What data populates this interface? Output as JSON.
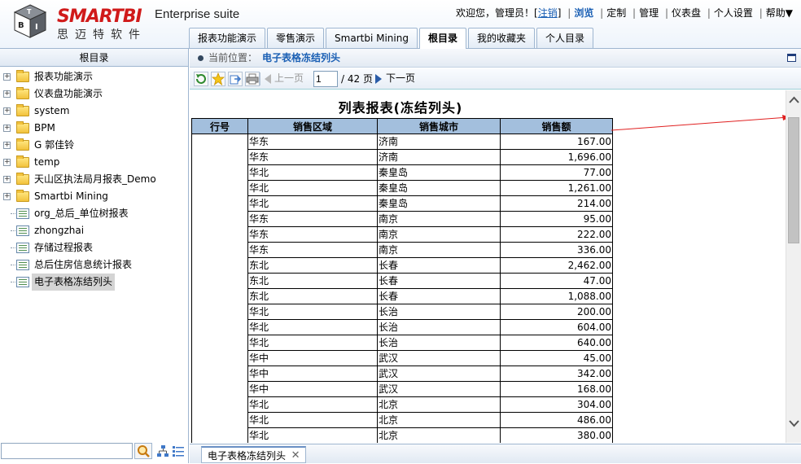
{
  "header": {
    "brand": "SMARTBI",
    "suite": "Enterprise suite",
    "brand_cn": "思迈特软件",
    "welcome": "欢迎您，管理员！[",
    "logout": "注销",
    "welcome_close": "]",
    "nav": [
      "浏览",
      "定制",
      "管理",
      "仪表盘",
      "个人设置",
      "帮助▼"
    ]
  },
  "main_tabs": [
    "报表功能演示",
    "零售演示",
    "Smartbi Mining",
    "根目录",
    "我的收藏夹",
    "个人目录"
  ],
  "main_tab_active": "根目录",
  "left_panel": {
    "title": "根目录",
    "tree": [
      {
        "label": "报表功能演示",
        "type": "folder"
      },
      {
        "label": "仪表盘功能演示",
        "type": "folder"
      },
      {
        "label": "system",
        "type": "folder"
      },
      {
        "label": "BPM",
        "type": "folder"
      },
      {
        "label": "G 郭佳铃",
        "type": "folder"
      },
      {
        "label": "temp",
        "type": "folder"
      },
      {
        "label": "天山区执法局月报表_Demo",
        "type": "folder"
      },
      {
        "label": "Smartbi Mining",
        "type": "folder"
      },
      {
        "label": "org_总后_单位树报表",
        "type": "report"
      },
      {
        "label": "zhongzhai",
        "type": "report"
      },
      {
        "label": "存储过程报表",
        "type": "report"
      },
      {
        "label": "总后住房信息统计报表",
        "type": "report"
      },
      {
        "label": "电子表格冻结列头",
        "type": "report"
      }
    ],
    "search_value": ""
  },
  "location": {
    "label": "当前位置：",
    "value": "电子表格冻结列头"
  },
  "toolbar": {
    "prev_label": "上一页",
    "page_value": "1",
    "page_total": "/ 42 页",
    "next_label": "下一页"
  },
  "report": {
    "title": "列表报表(冻结列头)",
    "columns": [
      "行号",
      "销售区域",
      "销售城市",
      "销售额"
    ],
    "rows": [
      [
        "华东",
        "济南",
        "167.00"
      ],
      [
        "华东",
        "济南",
        "1,696.00"
      ],
      [
        "华北",
        "秦皇岛",
        "77.00"
      ],
      [
        "华北",
        "秦皇岛",
        "1,261.00"
      ],
      [
        "华北",
        "秦皇岛",
        "214.00"
      ],
      [
        "华东",
        "南京",
        "95.00"
      ],
      [
        "华东",
        "南京",
        "222.00"
      ],
      [
        "华东",
        "南京",
        "336.00"
      ],
      [
        "东北",
        "长春",
        "2,462.00"
      ],
      [
        "东北",
        "长春",
        "47.00"
      ],
      [
        "东北",
        "长春",
        "1,088.00"
      ],
      [
        "华北",
        "长治",
        "200.00"
      ],
      [
        "华北",
        "长治",
        "604.00"
      ],
      [
        "华北",
        "长治",
        "640.00"
      ],
      [
        "华中",
        "武汉",
        "45.00"
      ],
      [
        "华中",
        "武汉",
        "342.00"
      ],
      [
        "华中",
        "武汉",
        "168.00"
      ],
      [
        "华北",
        "北京",
        "304.00"
      ],
      [
        "华北",
        "北京",
        "486.00"
      ],
      [
        "华北",
        "北京",
        "380.00"
      ]
    ]
  },
  "bottom_tab": "电子表格冻结列头",
  "colors": {
    "header_fill": "#a3bfdd",
    "brand_red": "#d01a1a",
    "link_blue": "#1a5fb4",
    "arrow_red": "#e02020"
  }
}
